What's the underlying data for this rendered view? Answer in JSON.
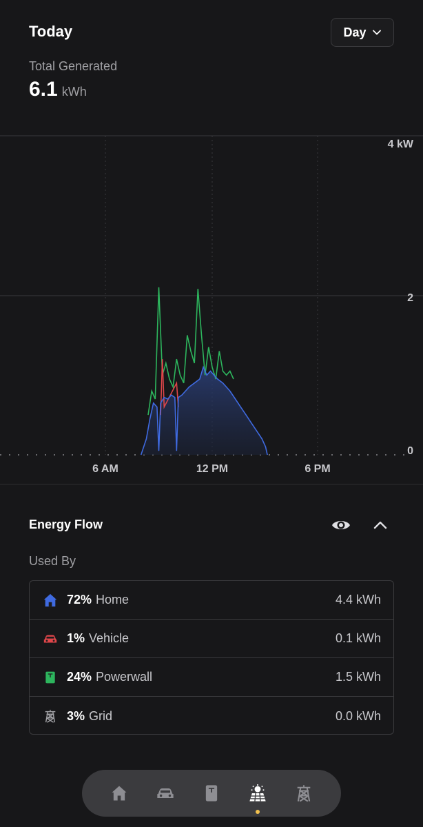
{
  "header": {
    "title": "Today",
    "period_label": "Day"
  },
  "summary": {
    "label": "Total Generated",
    "value": "6.1",
    "unit": "kWh"
  },
  "chart_data": {
    "type": "area",
    "y_unit_label": "4 kW",
    "ylim": [
      0,
      4
    ],
    "y_ticks": [
      "4 kW",
      "2",
      "0"
    ],
    "x_ticks": [
      "6 AM",
      "12 PM",
      "6 PM"
    ],
    "x_range_hours": [
      0,
      24
    ],
    "series": [
      {
        "color": "#3f6ae0",
        "values": [
          [
            8.0,
            0
          ],
          [
            8.3,
            0.2
          ],
          [
            8.5,
            0.45
          ],
          [
            8.7,
            0.65
          ],
          [
            8.9,
            0.6
          ],
          [
            9.0,
            0.05
          ],
          [
            9.1,
            0.65
          ],
          [
            9.3,
            0.72
          ],
          [
            9.5,
            0.7
          ],
          [
            9.7,
            0.75
          ],
          [
            9.9,
            0.72
          ],
          [
            10.0,
            0.05
          ],
          [
            10.1,
            0.72
          ],
          [
            10.3,
            0.75
          ],
          [
            10.5,
            0.8
          ],
          [
            10.7,
            0.85
          ],
          [
            11.0,
            0.9
          ],
          [
            11.3,
            0.95
          ],
          [
            11.5,
            1.1
          ],
          [
            11.7,
            1.0
          ],
          [
            11.9,
            1.05
          ],
          [
            12.1,
            1.0
          ],
          [
            12.3,
            0.95
          ],
          [
            12.6,
            0.9
          ],
          [
            12.8,
            0.85
          ],
          [
            13.0,
            0.8
          ],
          [
            13.3,
            0.7
          ],
          [
            13.6,
            0.6
          ],
          [
            13.9,
            0.5
          ],
          [
            14.2,
            0.4
          ],
          [
            14.5,
            0.3
          ],
          [
            14.8,
            0.2
          ],
          [
            15.0,
            0.1
          ],
          [
            15.1,
            0
          ]
        ]
      },
      {
        "color": "#2db55d",
        "values": [
          [
            8.4,
            0.5
          ],
          [
            8.6,
            0.8
          ],
          [
            8.8,
            0.7
          ],
          [
            9.0,
            2.1
          ],
          [
            9.2,
            1.0
          ],
          [
            9.4,
            1.15
          ],
          [
            9.6,
            0.95
          ],
          [
            9.8,
            0.85
          ],
          [
            10.0,
            1.2
          ],
          [
            10.2,
            1.0
          ],
          [
            10.4,
            0.9
          ],
          [
            10.6,
            1.5
          ],
          [
            10.8,
            1.3
          ],
          [
            11.0,
            1.15
          ],
          [
            11.2,
            2.08
          ],
          [
            11.4,
            1.5
          ],
          [
            11.6,
            1.0
          ],
          [
            11.8,
            1.35
          ],
          [
            12.0,
            1.1
          ],
          [
            12.2,
            0.95
          ],
          [
            12.4,
            1.3
          ],
          [
            12.6,
            1.05
          ],
          [
            12.8,
            1.0
          ],
          [
            13.0,
            1.05
          ],
          [
            13.2,
            0.95
          ]
        ]
      },
      {
        "color": "#e0464a",
        "values": [
          [
            9.1,
            0.5
          ],
          [
            9.2,
            1.2
          ],
          [
            9.3,
            0.6
          ],
          [
            10.0,
            0.9
          ],
          [
            10.1,
            0.6
          ]
        ]
      }
    ]
  },
  "energy_flow": {
    "title": "Energy Flow",
    "used_by_label": "Used By",
    "rows": [
      {
        "icon": "home-icon",
        "color": "#3f6ae0",
        "pct": "72%",
        "name": "Home",
        "value": "4.4 kWh"
      },
      {
        "icon": "vehicle-icon",
        "color": "#e0464a",
        "pct": "1%",
        "name": "Vehicle",
        "value": "0.1 kWh"
      },
      {
        "icon": "powerwall-icon",
        "color": "#2db55d",
        "pct": "24%",
        "name": "Powerwall",
        "value": "1.5 kWh"
      },
      {
        "icon": "grid-tower-icon",
        "color": "#a0a0a4",
        "pct": "3%",
        "name": "Grid",
        "value": "0.0 kWh"
      }
    ]
  },
  "bottom_nav": {
    "items": [
      "home-icon",
      "car-icon",
      "powerwall-icon",
      "solar-icon",
      "grid-tower-icon"
    ],
    "active_index": 3,
    "active_dot_color": "#f2c14e"
  }
}
